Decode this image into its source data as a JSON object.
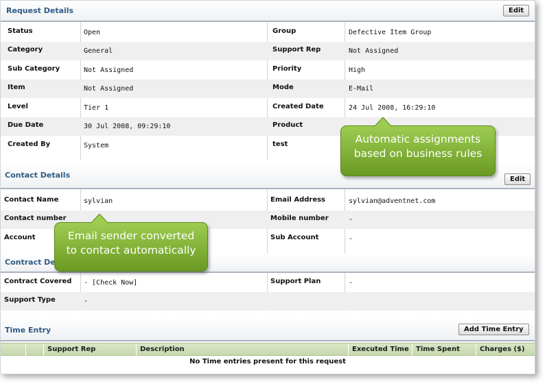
{
  "request": {
    "title": "Request Details",
    "edit_label": "Edit",
    "rows": [
      {
        "l1": "Status",
        "v1": "Open",
        "l2": "Group",
        "v2": "Defective Item Group"
      },
      {
        "l1": "Category",
        "v1": "General",
        "l2": "Support Rep",
        "v2": "Not Assigned"
      },
      {
        "l1": "Sub Category",
        "v1": "Not Assigned",
        "l2": "Priority",
        "v2": "High"
      },
      {
        "l1": "Item",
        "v1": "Not Assigned",
        "l2": "Mode",
        "v2": "E-Mail"
      },
      {
        "l1": "Level",
        "v1": "Tier 1",
        "l2": "Created Date",
        "v2": "24 Jul 2008, 16:29:10"
      },
      {
        "l1": "Due Date",
        "v1": "30 Jul 2008, 09:29:10",
        "l2": "Product",
        "v2": ""
      },
      {
        "l1": "Created By",
        "v1": "System",
        "l2": "test",
        "v2": ""
      }
    ]
  },
  "contact": {
    "title": "Contact Details",
    "edit_label": "Edit",
    "rows": [
      {
        "l1": "Contact Name",
        "v1": "sylvian",
        "l2": "Email Address",
        "v2": "sylvian@adventnet.com"
      },
      {
        "l1": "Contact number",
        "v1": "",
        "l2": "Mobile number",
        "v2": "-"
      },
      {
        "l1": "Account",
        "v1": "",
        "l2": "Sub Account",
        "v2": "-"
      }
    ]
  },
  "contract": {
    "title": "Contract Details",
    "rows": [
      {
        "l1": "Contract Covered",
        "v1": "- [Check Now]",
        "l2": "Support Plan",
        "v2": "-"
      },
      {
        "l1": "Support Type",
        "v1": "-",
        "l2": "",
        "v2": ""
      }
    ]
  },
  "time_entry": {
    "title": "Time Entry",
    "add_label": "Add Time Entry",
    "columns": [
      "Support Rep",
      "Description",
      "Executed Time",
      "Time Spent",
      "Charges ($)"
    ],
    "empty_text": "No Time entries present for this request"
  },
  "callouts": {
    "auto_assign": [
      "Automatic assignments",
      "based on business rules"
    ],
    "email_sender": [
      "Email sender converted",
      "to contact automatically"
    ]
  },
  "colors": {
    "section_title": "#2f5b85",
    "callout_green": "#7fb23a",
    "table_header": "#cfe0b8"
  }
}
